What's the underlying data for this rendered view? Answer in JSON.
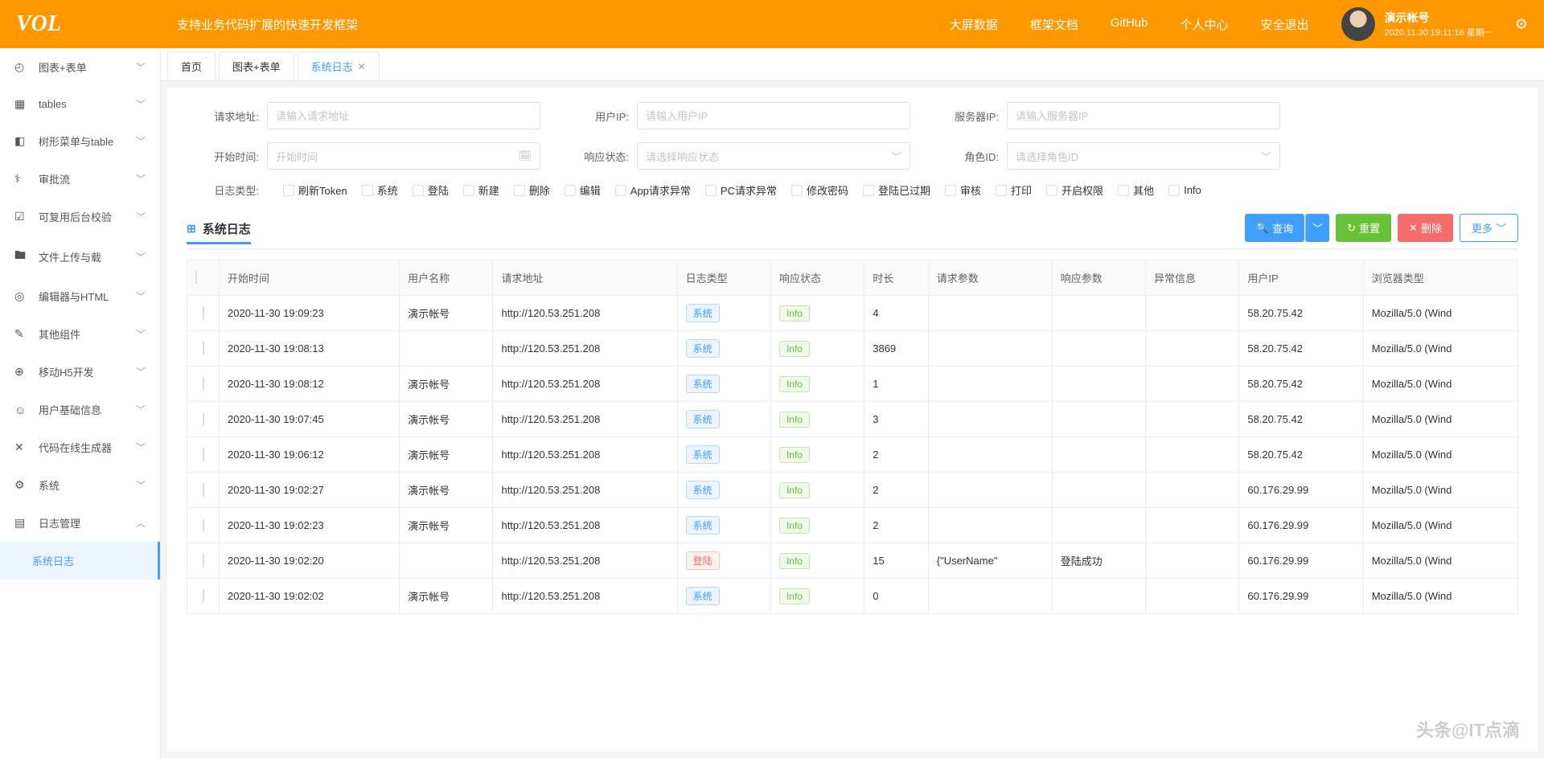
{
  "header": {
    "logo": "VOL",
    "subtitle": "支持业务代码扩展的快速开发框架",
    "nav": [
      "大屏数据",
      "框架文档",
      "GitHub",
      "个人中心",
      "安全退出"
    ],
    "user": {
      "name": "演示帐号",
      "time": "2020.11.30 19:11:16 星期一"
    }
  },
  "sidebar": [
    {
      "icon": "◴",
      "label": "图表+表单",
      "chevron": "﹀"
    },
    {
      "icon": "▦",
      "label": "tables",
      "chevron": "﹀"
    },
    {
      "icon": "◧",
      "label": "树形菜单与table",
      "chevron": "﹀"
    },
    {
      "icon": "⚕",
      "label": "审批流",
      "chevron": "﹀"
    },
    {
      "icon": "☑",
      "label": "可复用后台校验",
      "chevron": "﹀"
    },
    {
      "icon": "🖿",
      "label": "文件上传与载",
      "chevron": "﹀"
    },
    {
      "icon": "◎",
      "label": "编辑器与HTML",
      "chevron": "﹀"
    },
    {
      "icon": "✎",
      "label": "其他组件",
      "chevron": "﹀"
    },
    {
      "icon": "⊕",
      "label": "移动H5开发",
      "chevron": "﹀"
    },
    {
      "icon": "☺",
      "label": "用户基础信息",
      "chevron": "﹀"
    },
    {
      "icon": "✕",
      "label": "代码在线生成器",
      "chevron": "﹀"
    },
    {
      "icon": "⚙",
      "label": "系统",
      "chevron": "﹀"
    },
    {
      "icon": "▤",
      "label": "日志管理",
      "chevron": "︿"
    }
  ],
  "sidebarActive": "系统日志",
  "tabs": [
    {
      "label": "首页",
      "closable": false
    },
    {
      "label": "图表+表单",
      "closable": false
    },
    {
      "label": "系统日志",
      "closable": true,
      "active": true
    }
  ],
  "form": {
    "requestUrl": {
      "label": "请求地址:",
      "placeholder": "请输入请求地址"
    },
    "userIp": {
      "label": "用户IP:",
      "placeholder": "请输入用户IP"
    },
    "serverIp": {
      "label": "服务器IP:",
      "placeholder": "请输入服务器IP"
    },
    "startTime": {
      "label": "开始时间:",
      "placeholder": "开始时间"
    },
    "responseStatus": {
      "label": "响应状态:",
      "placeholder": "请选择响应状态"
    },
    "roleId": {
      "label": "角色ID:",
      "placeholder": "请选择角色ID"
    },
    "logType": {
      "label": "日志类型:",
      "options": [
        "刷新Token",
        "系统",
        "登陆",
        "新建",
        "删除",
        "编辑",
        "App请求异常",
        "PC请求异常",
        "修改密码",
        "登陆已过期",
        "审核",
        "打印",
        "开启权限",
        "其他",
        "Info"
      ]
    }
  },
  "section": {
    "title": "系统日志"
  },
  "buttons": {
    "search": "查询",
    "reset": "重置",
    "delete": "删除",
    "more": "更多"
  },
  "table": {
    "headers": [
      "开始时间",
      "用户名称",
      "请求地址",
      "日志类型",
      "响应状态",
      "时长",
      "请求参数",
      "响应参数",
      "异常信息",
      "用户IP",
      "浏览器类型"
    ],
    "rows": [
      {
        "time": "2020-11-30 19:09:23",
        "user": "演示帐号",
        "url": "http://120.53.251.208",
        "type": "系统",
        "typeClass": "system",
        "status": "Info",
        "duration": "4",
        "req": "",
        "res": "",
        "err": "",
        "ip": "58.20.75.42",
        "browser": "Mozilla/5.0 (Wind"
      },
      {
        "time": "2020-11-30 19:08:13",
        "user": "",
        "url": "http://120.53.251.208",
        "type": "系统",
        "typeClass": "system",
        "status": "Info",
        "duration": "3869",
        "req": "",
        "res": "",
        "err": "",
        "ip": "58.20.75.42",
        "browser": "Mozilla/5.0 (Wind"
      },
      {
        "time": "2020-11-30 19:08:12",
        "user": "演示帐号",
        "url": "http://120.53.251.208",
        "type": "系统",
        "typeClass": "system",
        "status": "Info",
        "duration": "1",
        "req": "",
        "res": "",
        "err": "",
        "ip": "58.20.75.42",
        "browser": "Mozilla/5.0 (Wind"
      },
      {
        "time": "2020-11-30 19:07:45",
        "user": "演示帐号",
        "url": "http://120.53.251.208",
        "type": "系统",
        "typeClass": "system",
        "status": "Info",
        "duration": "3",
        "req": "",
        "res": "",
        "err": "",
        "ip": "58.20.75.42",
        "browser": "Mozilla/5.0 (Wind"
      },
      {
        "time": "2020-11-30 19:06:12",
        "user": "演示帐号",
        "url": "http://120.53.251.208",
        "type": "系统",
        "typeClass": "system",
        "status": "Info",
        "duration": "2",
        "req": "",
        "res": "",
        "err": "",
        "ip": "58.20.75.42",
        "browser": "Mozilla/5.0 (Wind"
      },
      {
        "time": "2020-11-30 19:02:27",
        "user": "演示帐号",
        "url": "http://120.53.251.208",
        "type": "系统",
        "typeClass": "system",
        "status": "Info",
        "duration": "2",
        "req": "",
        "res": "",
        "err": "",
        "ip": "60.176.29.99",
        "browser": "Mozilla/5.0 (Wind"
      },
      {
        "time": "2020-11-30 19:02:23",
        "user": "演示帐号",
        "url": "http://120.53.251.208",
        "type": "系统",
        "typeClass": "system",
        "status": "Info",
        "duration": "2",
        "req": "",
        "res": "",
        "err": "",
        "ip": "60.176.29.99",
        "browser": "Mozilla/5.0 (Wind"
      },
      {
        "time": "2020-11-30 19:02:20",
        "user": "",
        "url": "http://120.53.251.208",
        "type": "登陆",
        "typeClass": "login",
        "status": "Info",
        "duration": "15",
        "req": "{\"UserName\"",
        "res": "登陆成功",
        "err": "",
        "ip": "60.176.29.99",
        "browser": "Mozilla/5.0 (Wind"
      },
      {
        "time": "2020-11-30 19:02:02",
        "user": "演示帐号",
        "url": "http://120.53.251.208",
        "type": "系统",
        "typeClass": "system",
        "status": "Info",
        "duration": "0",
        "req": "",
        "res": "",
        "err": "",
        "ip": "60.176.29.99",
        "browser": "Mozilla/5.0 (Wind"
      }
    ]
  },
  "watermark": "头条@IT点滴"
}
